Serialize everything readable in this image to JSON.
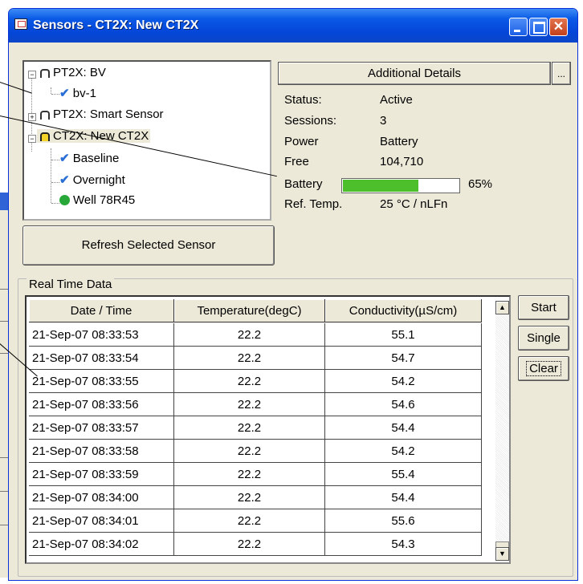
{
  "window": {
    "title": "Sensors - CT2X: New CT2X"
  },
  "tree": {
    "nodes": [
      {
        "label": "PT2X: BV"
      },
      {
        "label": "bv-1"
      },
      {
        "label": "PT2X: Smart Sensor"
      },
      {
        "label": "CT2X: New CT2X"
      },
      {
        "label": "Baseline"
      },
      {
        "label": "Overnight"
      },
      {
        "label": "Well 78R45"
      }
    ]
  },
  "refresh_label": "Refresh Selected Sensor",
  "details": {
    "button_label": "Additional Details",
    "ellipsis_label": "...",
    "rows": [
      {
        "label": "Status:",
        "value": "Active"
      },
      {
        "label": "Sessions:",
        "value": "3"
      },
      {
        "label": "Power",
        "value": "Battery"
      },
      {
        "label": "Free",
        "value": "104,710"
      },
      {
        "label": "Battery",
        "value": ""
      },
      {
        "label": "Ref. Temp.",
        "value": "25 °C / nLFn"
      }
    ],
    "battery_percent": 65,
    "battery_text": "65%"
  },
  "realtime": {
    "group_label": "Real Time Data",
    "columns": [
      "Date / Time",
      "Temperature(degC)",
      "Conductivity(µS/cm)"
    ],
    "rows": [
      [
        "21-Sep-07 08:33:53",
        "22.2",
        "55.1"
      ],
      [
        "21-Sep-07 08:33:54",
        "22.2",
        "54.7"
      ],
      [
        "21-Sep-07 08:33:55",
        "22.2",
        "54.2"
      ],
      [
        "21-Sep-07 08:33:56",
        "22.2",
        "54.6"
      ],
      [
        "21-Sep-07 08:33:57",
        "22.2",
        "54.4"
      ],
      [
        "21-Sep-07 08:33:58",
        "22.2",
        "54.2"
      ],
      [
        "21-Sep-07 08:33:59",
        "22.2",
        "55.4"
      ],
      [
        "21-Sep-07 08:34:00",
        "22.2",
        "54.4"
      ],
      [
        "21-Sep-07 08:34:01",
        "22.2",
        "55.6"
      ],
      [
        "21-Sep-07 08:34:02",
        "22.2",
        "54.3"
      ]
    ],
    "buttons": {
      "start": "Start",
      "single": "Single",
      "clear": "Clear"
    }
  },
  "colors": {
    "titlebar": "#0a59e6",
    "battery_fill": "#4dbf2a",
    "check": "#2a6fd6",
    "well": "#28a838"
  }
}
